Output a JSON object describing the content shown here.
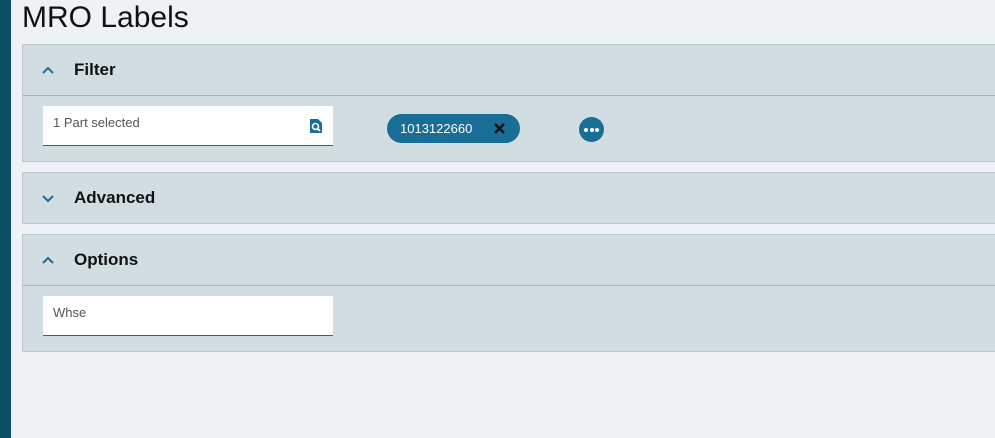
{
  "page": {
    "title": "MRO Labels"
  },
  "panels": {
    "filter": {
      "label": "Filter",
      "expanded": true,
      "part_field": {
        "value": "1 Part selected",
        "icon": "search-lookup-icon"
      },
      "selected_chip": {
        "value": "1013122660",
        "remove_icon": "close-icon"
      },
      "more_button_icon": "more-options-icon"
    },
    "advanced": {
      "label": "Advanced",
      "expanded": false
    },
    "options": {
      "label": "Options",
      "expanded": true,
      "whse_field": {
        "placeholder": "Whse"
      }
    }
  },
  "colors": {
    "accent": "#186e96",
    "sidebar": "#0a4f63",
    "panel_bg": "#d2dde1",
    "page_bg": "#eef2f5"
  }
}
